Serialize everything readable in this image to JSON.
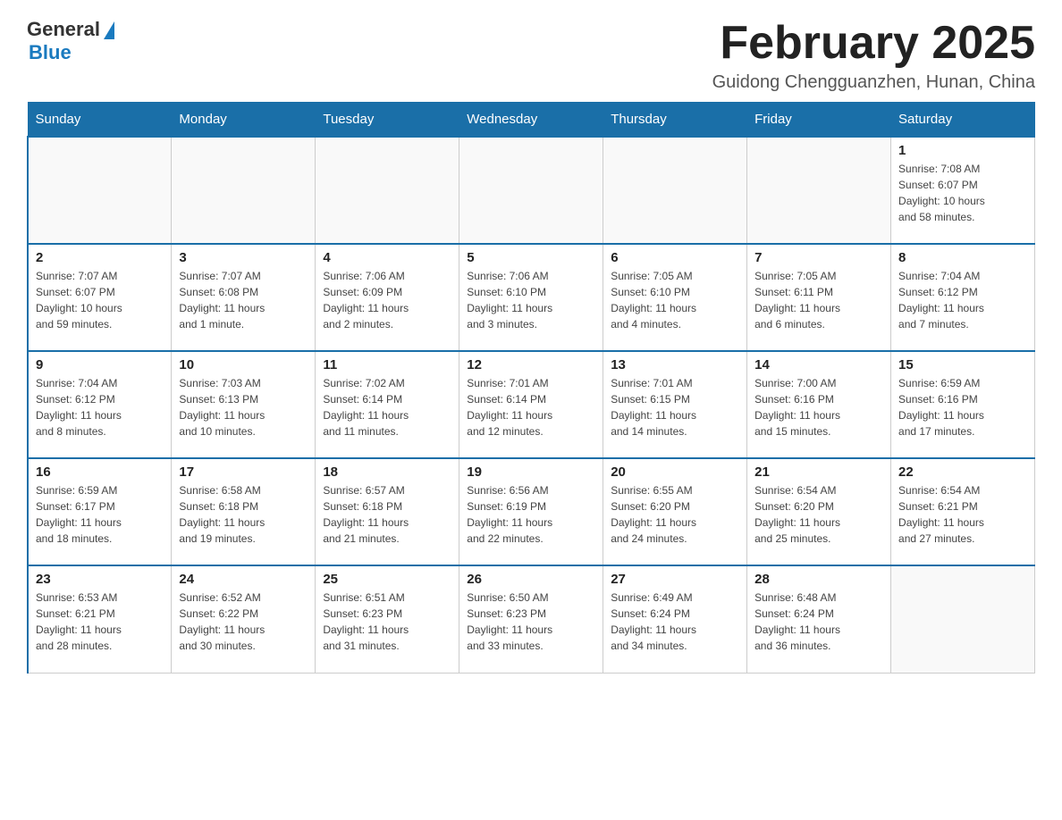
{
  "logo": {
    "general_text": "General",
    "blue_text": "Blue"
  },
  "title": "February 2025",
  "location": "Guidong Chengguanzhen, Hunan, China",
  "days_of_week": [
    "Sunday",
    "Monday",
    "Tuesday",
    "Wednesday",
    "Thursday",
    "Friday",
    "Saturday"
  ],
  "weeks": [
    [
      {
        "day": "",
        "info": ""
      },
      {
        "day": "",
        "info": ""
      },
      {
        "day": "",
        "info": ""
      },
      {
        "day": "",
        "info": ""
      },
      {
        "day": "",
        "info": ""
      },
      {
        "day": "",
        "info": ""
      },
      {
        "day": "1",
        "info": "Sunrise: 7:08 AM\nSunset: 6:07 PM\nDaylight: 10 hours\nand 58 minutes."
      }
    ],
    [
      {
        "day": "2",
        "info": "Sunrise: 7:07 AM\nSunset: 6:07 PM\nDaylight: 10 hours\nand 59 minutes."
      },
      {
        "day": "3",
        "info": "Sunrise: 7:07 AM\nSunset: 6:08 PM\nDaylight: 11 hours\nand 1 minute."
      },
      {
        "day": "4",
        "info": "Sunrise: 7:06 AM\nSunset: 6:09 PM\nDaylight: 11 hours\nand 2 minutes."
      },
      {
        "day": "5",
        "info": "Sunrise: 7:06 AM\nSunset: 6:10 PM\nDaylight: 11 hours\nand 3 minutes."
      },
      {
        "day": "6",
        "info": "Sunrise: 7:05 AM\nSunset: 6:10 PM\nDaylight: 11 hours\nand 4 minutes."
      },
      {
        "day": "7",
        "info": "Sunrise: 7:05 AM\nSunset: 6:11 PM\nDaylight: 11 hours\nand 6 minutes."
      },
      {
        "day": "8",
        "info": "Sunrise: 7:04 AM\nSunset: 6:12 PM\nDaylight: 11 hours\nand 7 minutes."
      }
    ],
    [
      {
        "day": "9",
        "info": "Sunrise: 7:04 AM\nSunset: 6:12 PM\nDaylight: 11 hours\nand 8 minutes."
      },
      {
        "day": "10",
        "info": "Sunrise: 7:03 AM\nSunset: 6:13 PM\nDaylight: 11 hours\nand 10 minutes."
      },
      {
        "day": "11",
        "info": "Sunrise: 7:02 AM\nSunset: 6:14 PM\nDaylight: 11 hours\nand 11 minutes."
      },
      {
        "day": "12",
        "info": "Sunrise: 7:01 AM\nSunset: 6:14 PM\nDaylight: 11 hours\nand 12 minutes."
      },
      {
        "day": "13",
        "info": "Sunrise: 7:01 AM\nSunset: 6:15 PM\nDaylight: 11 hours\nand 14 minutes."
      },
      {
        "day": "14",
        "info": "Sunrise: 7:00 AM\nSunset: 6:16 PM\nDaylight: 11 hours\nand 15 minutes."
      },
      {
        "day": "15",
        "info": "Sunrise: 6:59 AM\nSunset: 6:16 PM\nDaylight: 11 hours\nand 17 minutes."
      }
    ],
    [
      {
        "day": "16",
        "info": "Sunrise: 6:59 AM\nSunset: 6:17 PM\nDaylight: 11 hours\nand 18 minutes."
      },
      {
        "day": "17",
        "info": "Sunrise: 6:58 AM\nSunset: 6:18 PM\nDaylight: 11 hours\nand 19 minutes."
      },
      {
        "day": "18",
        "info": "Sunrise: 6:57 AM\nSunset: 6:18 PM\nDaylight: 11 hours\nand 21 minutes."
      },
      {
        "day": "19",
        "info": "Sunrise: 6:56 AM\nSunset: 6:19 PM\nDaylight: 11 hours\nand 22 minutes."
      },
      {
        "day": "20",
        "info": "Sunrise: 6:55 AM\nSunset: 6:20 PM\nDaylight: 11 hours\nand 24 minutes."
      },
      {
        "day": "21",
        "info": "Sunrise: 6:54 AM\nSunset: 6:20 PM\nDaylight: 11 hours\nand 25 minutes."
      },
      {
        "day": "22",
        "info": "Sunrise: 6:54 AM\nSunset: 6:21 PM\nDaylight: 11 hours\nand 27 minutes."
      }
    ],
    [
      {
        "day": "23",
        "info": "Sunrise: 6:53 AM\nSunset: 6:21 PM\nDaylight: 11 hours\nand 28 minutes."
      },
      {
        "day": "24",
        "info": "Sunrise: 6:52 AM\nSunset: 6:22 PM\nDaylight: 11 hours\nand 30 minutes."
      },
      {
        "day": "25",
        "info": "Sunrise: 6:51 AM\nSunset: 6:23 PM\nDaylight: 11 hours\nand 31 minutes."
      },
      {
        "day": "26",
        "info": "Sunrise: 6:50 AM\nSunset: 6:23 PM\nDaylight: 11 hours\nand 33 minutes."
      },
      {
        "day": "27",
        "info": "Sunrise: 6:49 AM\nSunset: 6:24 PM\nDaylight: 11 hours\nand 34 minutes."
      },
      {
        "day": "28",
        "info": "Sunrise: 6:48 AM\nSunset: 6:24 PM\nDaylight: 11 hours\nand 36 minutes."
      },
      {
        "day": "",
        "info": ""
      }
    ]
  ]
}
